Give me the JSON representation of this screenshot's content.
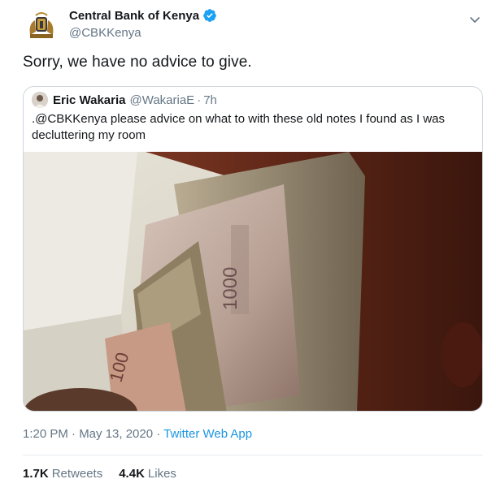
{
  "tweet": {
    "author": {
      "display_name": "Central Bank of Kenya",
      "handle": "@CBKKenya",
      "verified": true
    },
    "text": "Sorry, we have no advice to give.",
    "timestamp": "1:20 PM · May 13, 2020",
    "separator": " · ",
    "source_app": "Twitter Web App",
    "stats": {
      "retweets_count": "1.7K",
      "retweets_label": "Retweets",
      "likes_count": "4.4K",
      "likes_label": "Likes"
    }
  },
  "quoted": {
    "display_name": "Eric Wakaria",
    "handle": "@WakariaE",
    "separator": "·",
    "age": "7h",
    "text": ".@CBKKenya please advice on what to with these old notes I found as I was decluttering my room"
  },
  "icons": {
    "avatar": "cbk-crest-icon",
    "verified": "verified-badge-icon",
    "caret": "chevron-down-icon"
  },
  "colors": {
    "link": "#1b95e0",
    "verified": "#1da1f2",
    "muted": "#657786",
    "border": "#ccd6dd"
  }
}
